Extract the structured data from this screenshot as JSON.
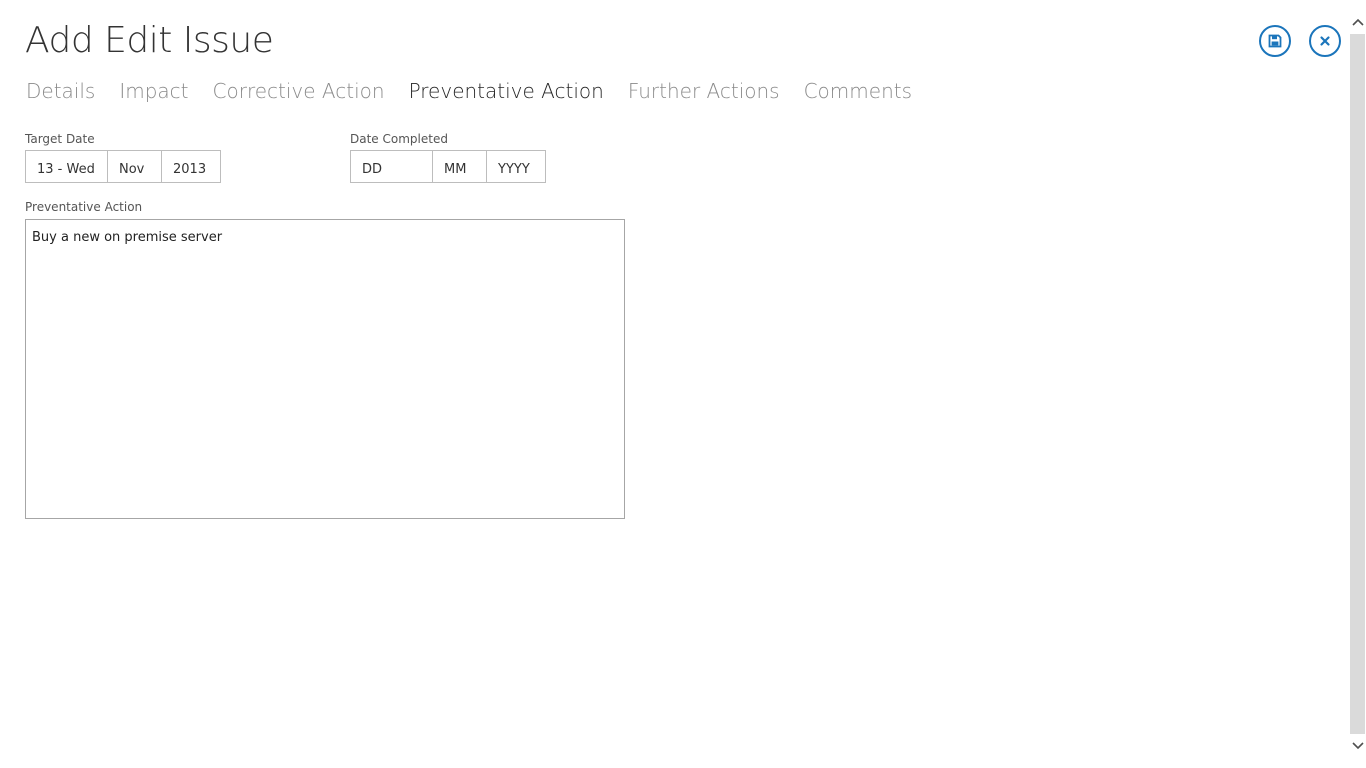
{
  "header": {
    "title": "Add Edit Issue",
    "save_icon": "save-icon",
    "close_icon": "close-icon",
    "accent_color": "#1b75bb"
  },
  "tabs": [
    {
      "label": "Details",
      "active": false
    },
    {
      "label": "Impact",
      "active": false
    },
    {
      "label": "Corrective Action",
      "active": false
    },
    {
      "label": "Preventative Action",
      "active": true
    },
    {
      "label": "Further Actions",
      "active": false
    },
    {
      "label": "Comments",
      "active": false
    }
  ],
  "target_date": {
    "label": "Target Date",
    "day": "13 - Wed",
    "month": "Nov",
    "year": "2013"
  },
  "date_completed": {
    "label": "Date Completed",
    "day": "DD",
    "month": "MM",
    "year": "YYYY"
  },
  "preventative_action": {
    "label": "Preventative Action",
    "value": "Buy a new on premise server"
  }
}
